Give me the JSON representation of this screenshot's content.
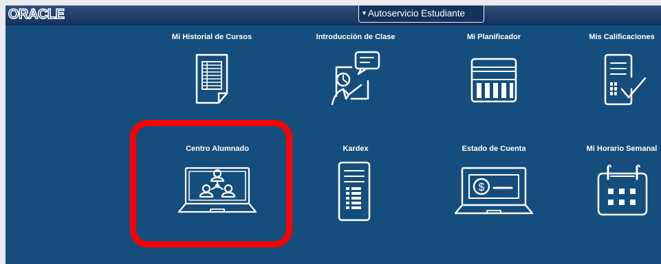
{
  "header": {
    "logo_text": "ORACLE",
    "homepage_selector": "Autoservicio Estudiante"
  },
  "tiles": [
    {
      "label": "Mi Historial de Cursos",
      "icon": "course-history-document-icon"
    },
    {
      "label": "Introducción de Clase",
      "icon": "class-presentation-icon"
    },
    {
      "label": "Mi Planificador",
      "icon": "planner-icon"
    },
    {
      "label": "Mis Calificaciones",
      "icon": "grades-checklist-icon"
    },
    {
      "label": "Centro Alumnado",
      "icon": "student-center-laptop-icon"
    },
    {
      "label": "Kardex",
      "icon": "kardex-document-icon"
    },
    {
      "label": "Estado de Cuenta",
      "icon": "account-statement-icon"
    },
    {
      "label": "Mi Horario Semanal",
      "icon": "weekly-calendar-icon"
    }
  ],
  "annotation": {
    "highlighted_tile": "Centro Alumnado",
    "highlight_color": "#ff0000"
  }
}
